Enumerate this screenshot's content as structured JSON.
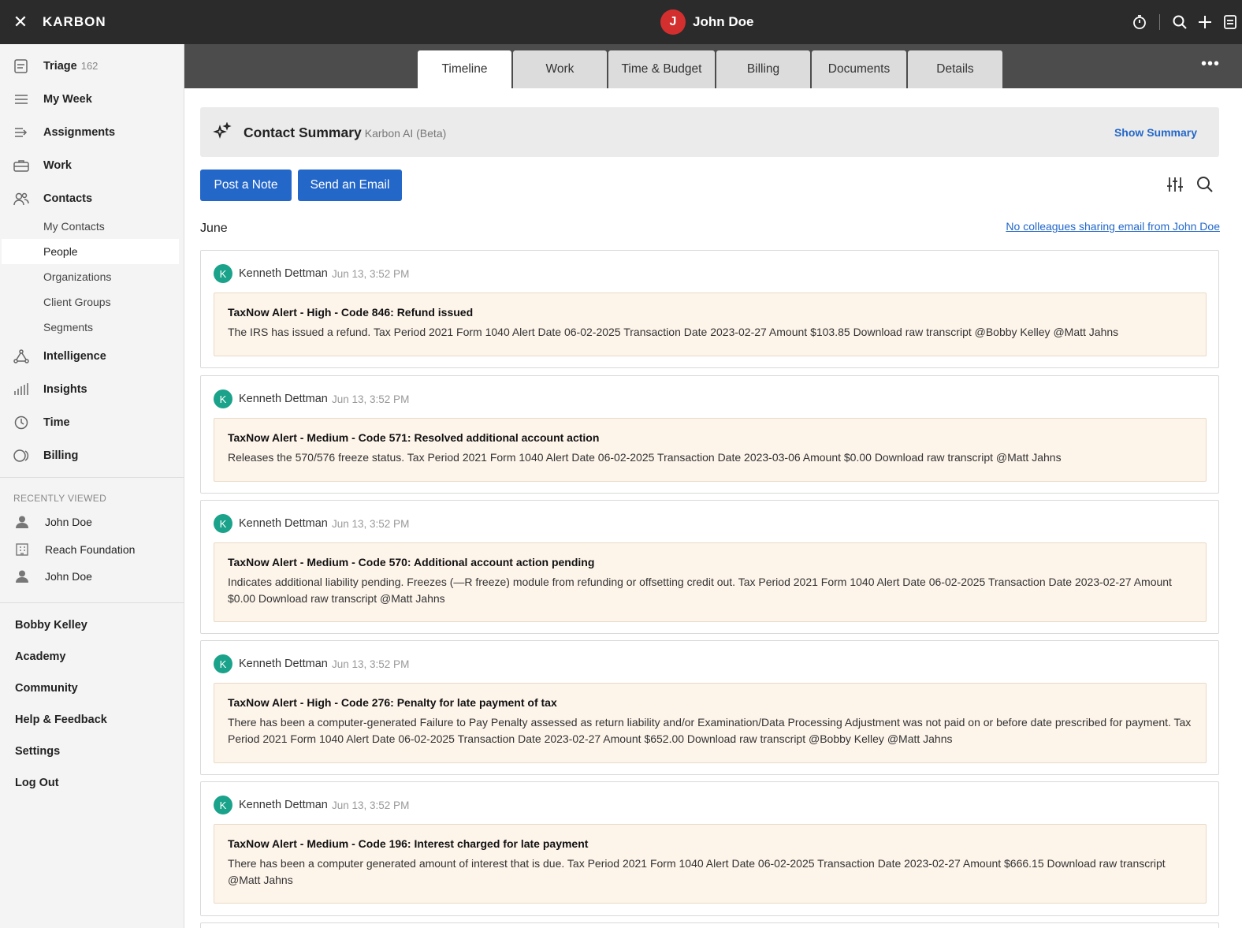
{
  "topbar": {
    "brand": "KARBON",
    "user_initial": "J",
    "user_name": "John Doe"
  },
  "sidebar": {
    "items": [
      {
        "label": "Triage",
        "count": "162",
        "icon": "triage-icon"
      },
      {
        "label": "My Week",
        "icon": "list-icon"
      },
      {
        "label": "Assignments",
        "icon": "assignments-icon"
      },
      {
        "label": "Work",
        "icon": "briefcase-icon"
      },
      {
        "label": "Contacts",
        "icon": "contacts-icon"
      }
    ],
    "contact_sub": [
      "My Contacts",
      "People",
      "Organizations",
      "Client Groups",
      "Segments"
    ],
    "active_sub": "People",
    "items2": [
      {
        "label": "Intelligence",
        "icon": "intelligence-icon"
      },
      {
        "label": "Insights",
        "icon": "bar-chart-icon"
      },
      {
        "label": "Time",
        "icon": "clock-icon"
      },
      {
        "label": "Billing",
        "icon": "billing-icon"
      }
    ],
    "recently_viewed_title": "RECENTLY VIEWED",
    "recently_viewed": [
      {
        "label": "John Doe",
        "icon": "person-icon"
      },
      {
        "label": "Reach Foundation",
        "icon": "building-icon"
      },
      {
        "label": "John Doe",
        "icon": "person-icon"
      }
    ],
    "bottom": [
      "Bobby Kelley",
      "Academy",
      "Community",
      "Help & Feedback",
      "Settings",
      "Log Out"
    ]
  },
  "tabs": [
    "Timeline",
    "Work",
    "Time & Budget",
    "Billing",
    "Documents",
    "Details"
  ],
  "active_tab": "Timeline",
  "summary": {
    "title": "Contact Summary",
    "subtitle": "Karbon AI (Beta)",
    "action": "Show Summary"
  },
  "actions": {
    "post_note": "Post a Note",
    "send_email": "Send an Email"
  },
  "month": "June",
  "no_colleagues": "No colleagues sharing email from John Doe",
  "colors": {
    "accent": "#2367c9",
    "avatar_red": "#d32f2f",
    "avatar_teal": "#1aa38a",
    "alert_bg": "#fdf4ea"
  },
  "timeline": [
    {
      "initial": "K",
      "author": "Kenneth Dettman",
      "time": "Jun 13, 3:52 PM",
      "title": "TaxNow Alert - High - Code 846: Refund issued",
      "body": "The IRS has issued a refund. Tax Period 2021 Form 1040 Alert Date 06-02-2025 Transaction Date 2023-02-27 Amount $103.85 Download raw transcript @Bobby Kelley @Matt Jahns"
    },
    {
      "initial": "K",
      "author": "Kenneth Dettman",
      "time": "Jun 13, 3:52 PM",
      "title": "TaxNow Alert - Medium - Code 571: Resolved additional account action",
      "body": "Releases the 570/576 freeze status. Tax Period 2021 Form 1040 Alert Date 06-02-2025 Transaction Date 2023-03-06 Amount $0.00 Download raw transcript @Matt Jahns"
    },
    {
      "initial": "K",
      "author": "Kenneth Dettman",
      "time": "Jun 13, 3:52 PM",
      "title": "TaxNow Alert - Medium - Code 570: Additional account action pending",
      "body": "Indicates additional liability pending. Freezes (—R freeze) module from refunding or offsetting credit out. Tax Period 2021 Form 1040 Alert Date 06-02-2025 Transaction Date 2023-02-27 Amount $0.00 Download raw transcript @Matt Jahns"
    },
    {
      "initial": "K",
      "author": "Kenneth Dettman",
      "time": "Jun 13, 3:52 PM",
      "title": "TaxNow Alert - High - Code 276: Penalty for late payment of tax",
      "body": "There has been a computer-generated Failure to Pay Penalty assessed as return liability and/or Examination/Data Processing Adjustment was not paid on or before date prescribed for payment. Tax Period 2021 Form 1040 Alert Date 06-02-2025 Transaction Date 2023-02-27 Amount $652.00 Download raw transcript @Bobby Kelley @Matt Jahns"
    },
    {
      "initial": "K",
      "author": "Kenneth Dettman",
      "time": "Jun 13, 3:52 PM",
      "title": "TaxNow Alert - Medium - Code 196: Interest charged for late payment",
      "body": "There has been a computer generated amount of interest that is due. Tax Period 2021 Form 1040 Alert Date 06-02-2025 Transaction Date 2023-02-27 Amount $666.15 Download raw transcript @Matt Jahns"
    }
  ]
}
